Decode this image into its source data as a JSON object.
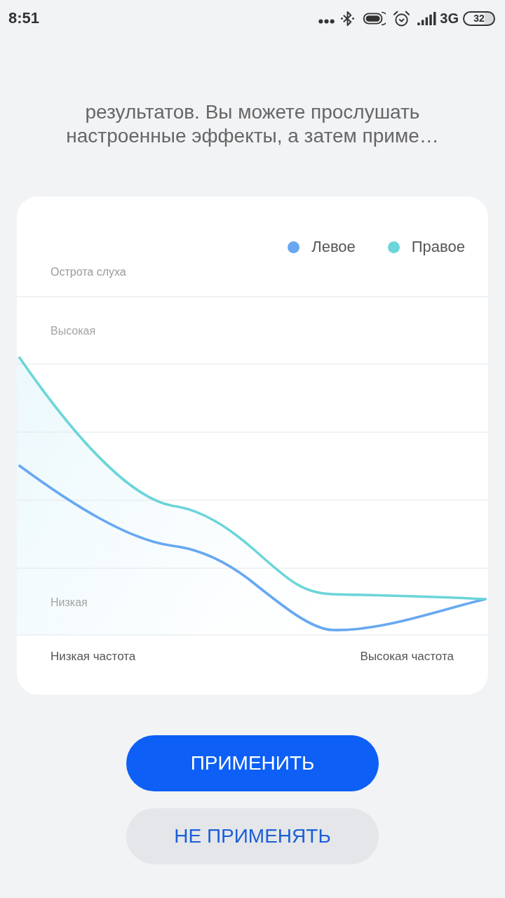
{
  "status_bar": {
    "time": "8:51",
    "network": "3G",
    "battery": "32"
  },
  "description": {
    "lines": [
      "результатов. Вы можете прослушать",
      "настроенные эффекты, а затем приме…"
    ]
  },
  "chart": {
    "legend": [
      {
        "label": "Левое",
        "color": "#67a8f1"
      },
      {
        "label": "Правое",
        "color": "#6bd5d9"
      }
    ],
    "y_title": "Острота слуха",
    "y_high": "Высокая",
    "y_low": "Низкая",
    "x_low": "Низкая частота",
    "x_high": "Высокая частота"
  },
  "buttons": [
    {
      "label": "ПРИМЕНИТЬ",
      "kind": "primary"
    },
    {
      "label": "НЕ ПРИМЕНЯТЬ",
      "kind": "secondary"
    }
  ]
}
